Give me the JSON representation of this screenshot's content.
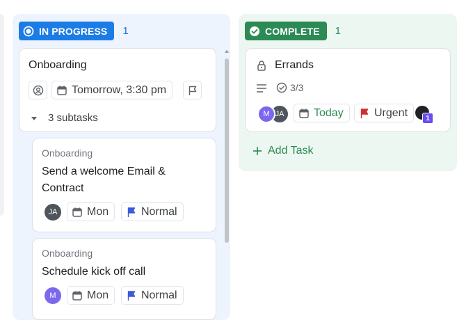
{
  "in_progress": {
    "status": "IN PROGRESS",
    "count": "1",
    "color": "#1c7ce6",
    "parent_task": {
      "title": "Onboarding",
      "due": "Tomorrow, 3:30 pm",
      "subtasks_label": "3 subtasks"
    },
    "subtasks": [
      {
        "crumb": "Onboarding",
        "title_line1": "Send a welcome Email &",
        "title_line2": "Contract",
        "assignee": "JA",
        "due": "Mon",
        "priority": "Normal"
      },
      {
        "crumb": "Onboarding",
        "title": "Schedule kick off call",
        "assignee": "M",
        "due": "Mon",
        "priority": "Normal"
      }
    ]
  },
  "complete": {
    "status": "COMPLETE",
    "count": "1",
    "color": "#2c8a55",
    "task": {
      "title": "Errands",
      "checklist": "3/3",
      "assignees": [
        "M",
        "JA"
      ],
      "due": "Today",
      "priority": "Urgent",
      "watcher_badge": "1"
    },
    "add_task_label": "Add Task"
  },
  "colors": {
    "normal_flag": "#3b5bdb",
    "urgent_flag": "#d32f2f",
    "today_text": "#2c8a55"
  }
}
